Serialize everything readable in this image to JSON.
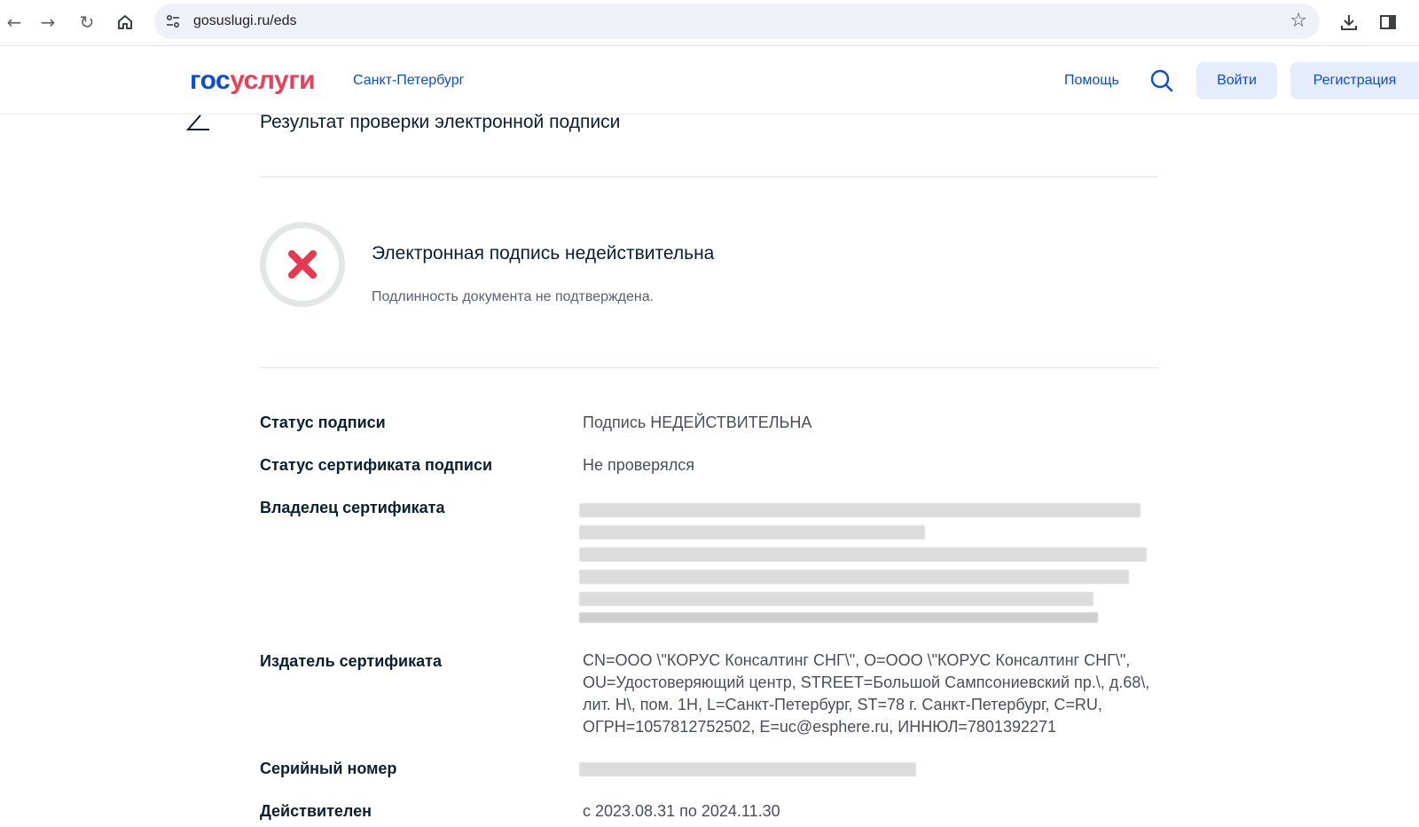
{
  "browser": {
    "url": "gosuslugi.ru/eds"
  },
  "header": {
    "logo_part1": "гос",
    "logo_part2": "услуги",
    "region": "Санкт-Петербург",
    "help": "Помощь",
    "login_label": "Войти",
    "register_label": "Регистрация"
  },
  "page": {
    "title": "Результат проверки электронной подписи",
    "result_title": "Электронная подпись недействительна",
    "result_subtitle": "Подлинность документа не подтверждена.",
    "rows": [
      {
        "label": "Статус подписи",
        "value": "Подпись НЕДЕЙСТВИТЕЛЬНА"
      },
      {
        "label": "Статус сертификата подписи",
        "value": "Не проверялся"
      },
      {
        "label": "Владелец сертификата",
        "value": ""
      },
      {
        "label": "Издатель сертификата",
        "value": "CN=ООО \\\"КОРУС Консалтинг СНГ\\\", O=ООО \\\"КОРУС Консалтинг СНГ\\\", OU=Удостоверяющий центр, STREET=Большой Сампсониевский пр.\\, д.68\\, лит. Н\\, пом. 1Н, L=Санкт-Петербург, ST=78 г. Санкт-Петербург, C=RU, ОГРН=1057812752502, E=uc@esphere.ru, ИННЮЛ=7801392271"
      },
      {
        "label": "Серийный номер",
        "value": ""
      },
      {
        "label": "Действителен",
        "value": "с 2023.08.31 по 2024.11.30"
      }
    ]
  },
  "colors": {
    "brand_blue": "#0d4cd3",
    "brand_red": "#ee3f58",
    "error_red": "#e8384f"
  }
}
